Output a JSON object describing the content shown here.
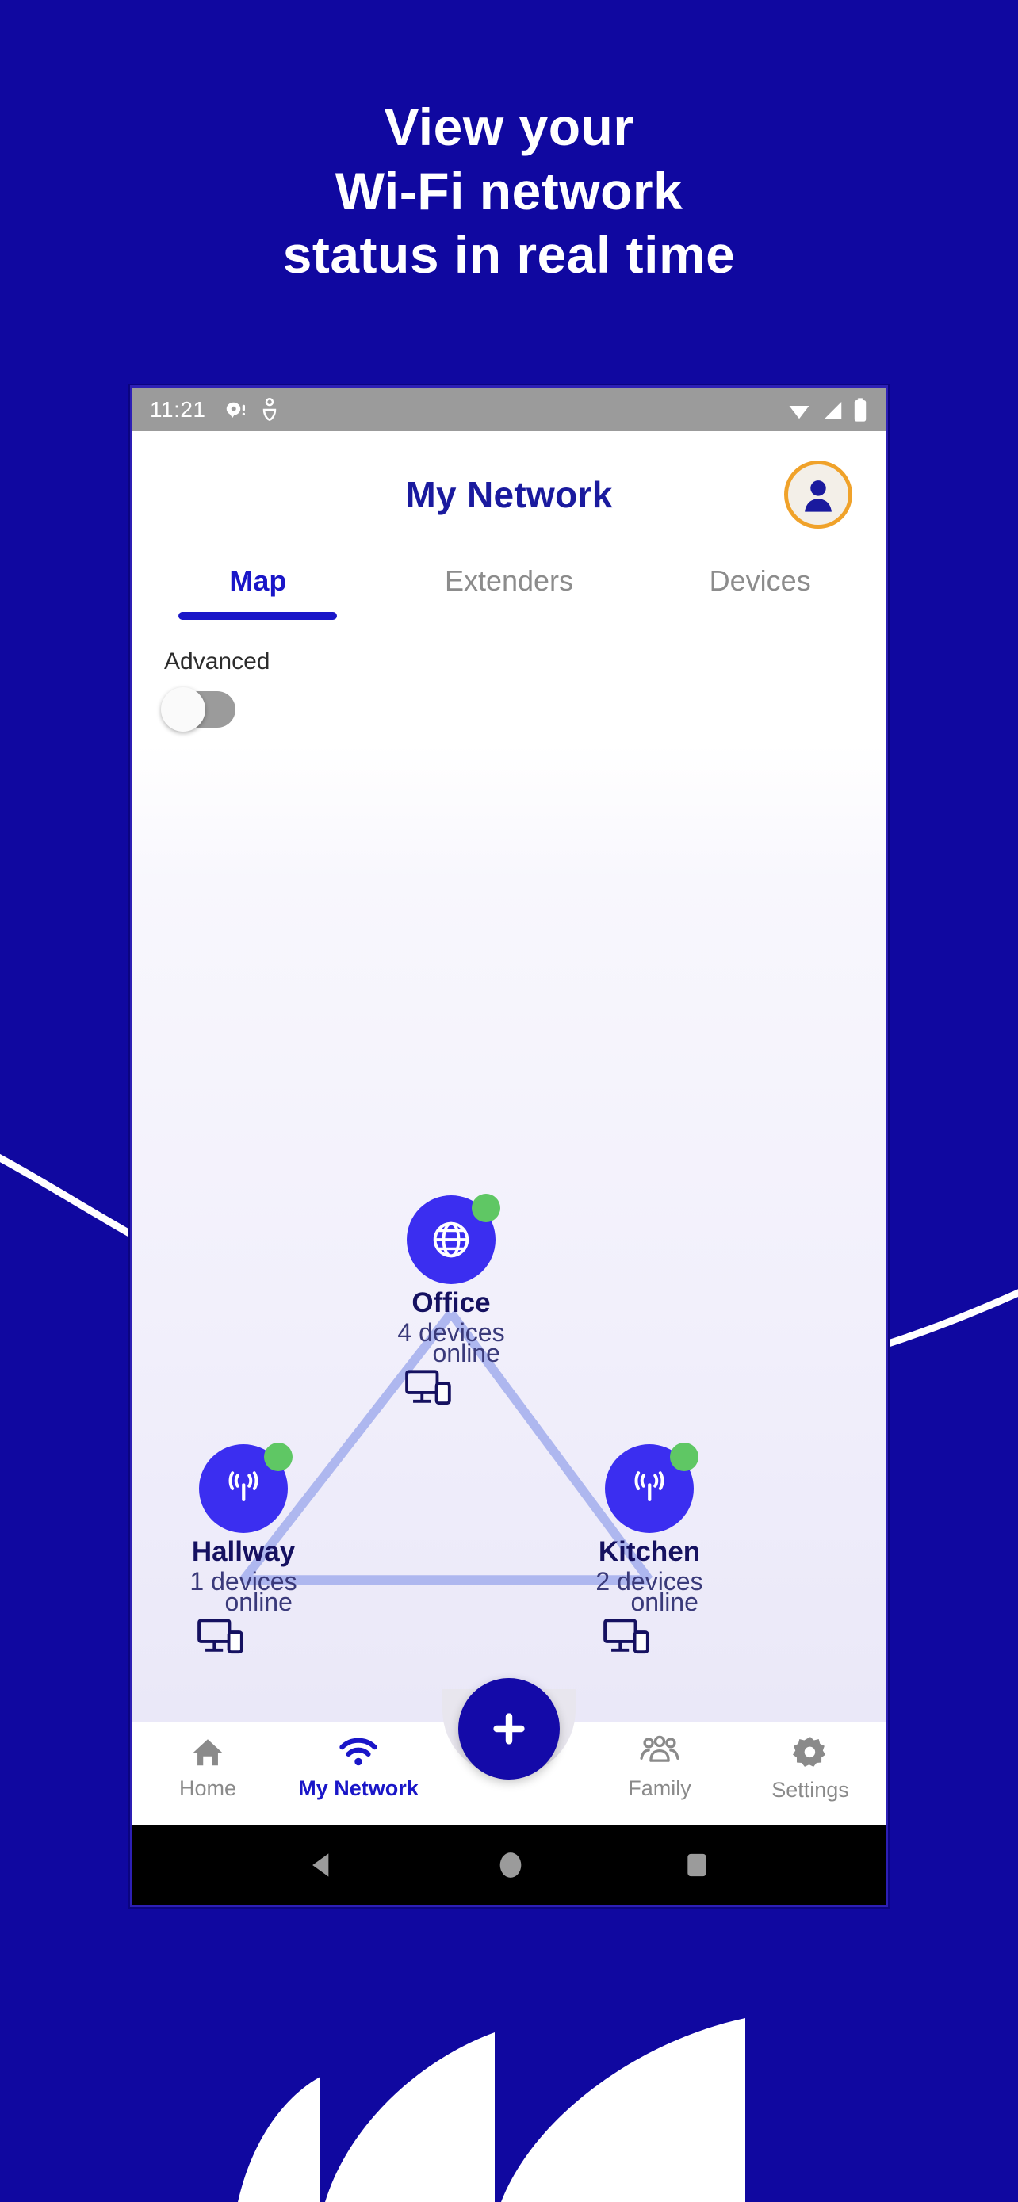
{
  "colors": {
    "bg_blue": "#1008a0",
    "accent_blue": "#1a16c8",
    "node_blue": "#3b2ef0",
    "status_green": "#5fc764",
    "avatar_ring_orange": "#f0a22a",
    "link_line": "#aeb7ef",
    "muted_gray": "#8a8a8a"
  },
  "headline": {
    "line1": "View your",
    "line2": "Wi-Fi network",
    "line3": "status in real time"
  },
  "phone": {
    "status_bar": {
      "clock": "11:21",
      "left_icons": [
        "message-notification-icon",
        "bluetooth-audio-icon"
      ],
      "right_icons": [
        "wifi-icon",
        "cellular-signal-icon",
        "battery-icon"
      ]
    },
    "header": {
      "title": "My Network",
      "avatar_icon": "user-avatar-icon"
    },
    "tabs": [
      {
        "label": "Map",
        "active": true
      },
      {
        "label": "Extenders",
        "active": false
      },
      {
        "label": "Devices",
        "active": false
      }
    ],
    "advanced": {
      "label": "Advanced",
      "toggle_state": "off"
    },
    "map": {
      "nodes": [
        {
          "id": "office",
          "name": "Office",
          "count_text": "4 devices",
          "online_text": "online",
          "icon": "globe-icon",
          "status": "online",
          "device_icon": "monitor-phone-icon"
        },
        {
          "id": "hallway",
          "name": "Hallway",
          "count_text": "1 devices",
          "online_text": "online",
          "icon": "wifi-tower-icon",
          "status": "online",
          "device_icon": "monitor-phone-icon"
        },
        {
          "id": "kitchen",
          "name": "Kitchen",
          "count_text": "2 devices",
          "online_text": "online",
          "icon": "wifi-tower-icon",
          "status": "online",
          "device_icon": "monitor-phone-icon"
        }
      ],
      "links": [
        [
          "office",
          "hallway"
        ],
        [
          "office",
          "kitchen"
        ],
        [
          "hallway",
          "kitchen"
        ]
      ]
    },
    "fab": {
      "label": "+",
      "icon": "plus-icon"
    },
    "bottom_nav": [
      {
        "label": "Home",
        "icon": "home-icon",
        "active": false
      },
      {
        "label": "My Network",
        "icon": "wifi-icon",
        "active": true
      },
      {
        "label": "Family",
        "icon": "people-group-icon",
        "active": false
      },
      {
        "label": "Settings",
        "icon": "gear-icon",
        "active": false
      }
    ],
    "android_nav": [
      "back-triangle-icon",
      "home-circle-icon",
      "recents-square-icon"
    ]
  }
}
